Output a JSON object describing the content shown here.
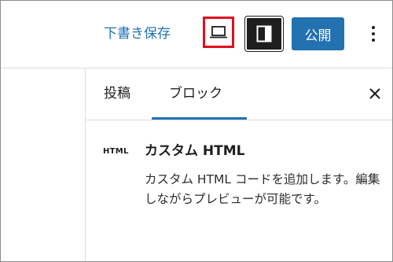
{
  "toolbar": {
    "save_draft_label": "下書き保存",
    "preview_icon": "laptop-icon",
    "settings_icon": "sidebar-panel-icon",
    "publish_label": "公開",
    "more_icon": "more-vertical-icon"
  },
  "sidebar": {
    "tabs": [
      {
        "label": "投稿"
      },
      {
        "label": "ブロック"
      }
    ],
    "close_icon": "close-icon",
    "block": {
      "icon_text": "HTML",
      "title": "カスタム HTML",
      "description": "カスタム HTML コードを追加します。編集しながらプレビューが可能です。"
    }
  },
  "colors": {
    "accent": "#2271b1",
    "highlight": "#e0101d",
    "dark": "#1e1e1e"
  }
}
